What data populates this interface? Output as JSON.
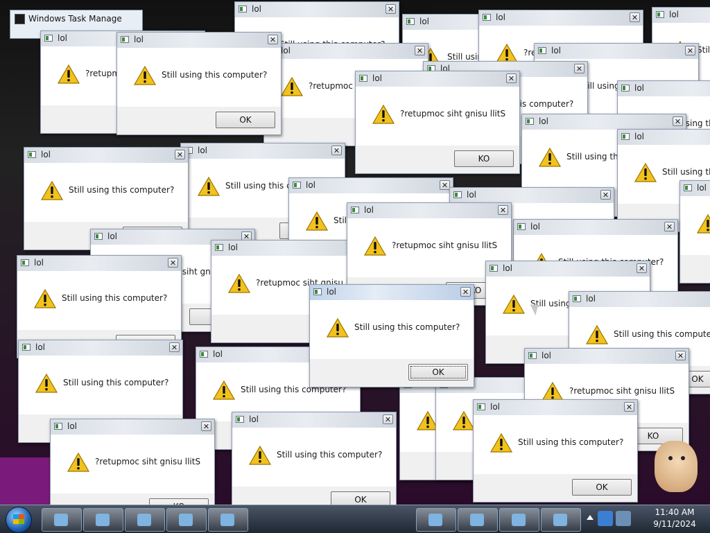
{
  "task_manager": {
    "title": "Windows Task Manage"
  },
  "dialog": {
    "title": "lol",
    "close_glyph": "✕"
  },
  "messages": {
    "normal": "Still using this computer?",
    "reversed": "?retupmoc siht gnisu llitS"
  },
  "buttons": {
    "ok": "OK",
    "ko": "KO"
  },
  "icons": {
    "dialog_icon": "warning-icon",
    "app_icon": "window-icon",
    "start": "windows-orb-icon"
  },
  "colors": {
    "warning_yellow": "#f2c21d",
    "taskbar": "#1f2733",
    "accent_purple": "#7a1a7a"
  },
  "clock": {
    "time": "11:40 AM",
    "date": "9/11/2024"
  }
}
